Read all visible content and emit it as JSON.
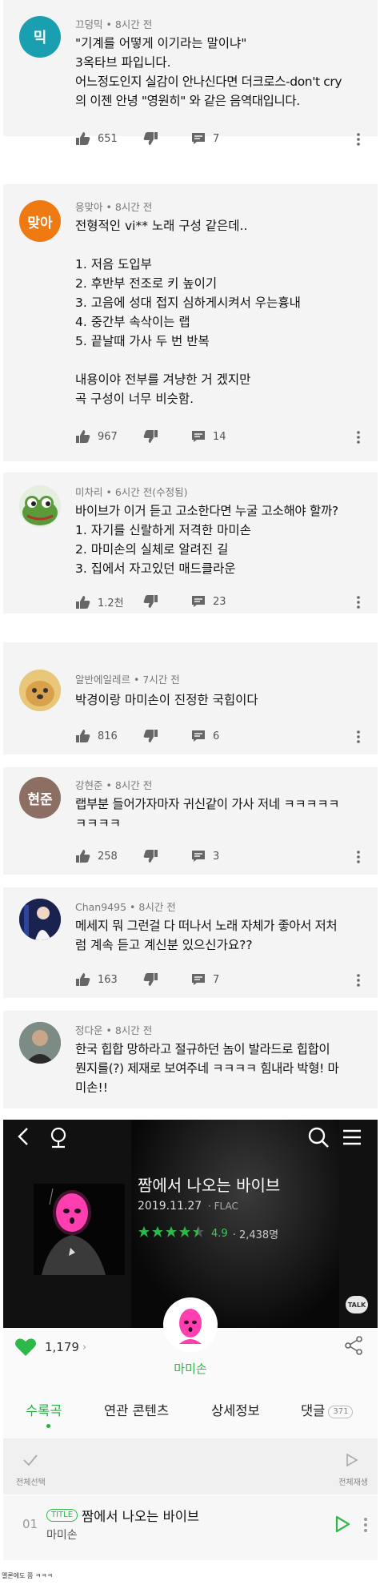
{
  "comments": [
    {
      "author": "끄덩믹",
      "time": "8시간 전",
      "avatar_text": "믹",
      "avatar_color": "#1a9fb0",
      "lines": [
        "\"기계를 어떻게 이기라는 말이냐\"",
        "3옥타브 파입니다.",
        "어느정도인지 실감이 안나신다면 더크로스-don't cry",
        "의 이젠 안녕 \"영원히\" 와 같은 음역대입니다."
      ],
      "likes": "651",
      "replies": "7"
    },
    {
      "author": "응맞아",
      "time": "8시간 전",
      "avatar_text": "맞아",
      "avatar_color": "#f07a12",
      "lines": [
        "전형적인 vi** 노래 구성 같은데..",
        "",
        "1. 저음 도입부",
        "2. 후반부 전조로 키 높이기",
        "3. 고음에 성대 접지 심하게시켜서 우는흉내",
        "4. 중간부 속삭이는 랩",
        "5. 끝날때 가사 두 번 반복",
        "",
        "내용이야 전부를 겨냥한 거 겠지만",
        "곡 구성이 너무 비슷함."
      ],
      "likes": "967",
      "replies": "14"
    },
    {
      "author": "미차리",
      "time": "6시간 전(수정됨)",
      "avatar_text": "",
      "avatar_color": "#d7e6d2",
      "lines": [
        "바이브가 이거 듣고 고소한다면 누굴 고소해야 할까?",
        "1. 자기를 신랄하게 저격한 마미손",
        "2. 마미손의 실체로 알려진 길",
        "3. 집에서 자고있던 매드클라운"
      ],
      "likes": "1.2천",
      "replies": "23"
    },
    {
      "author": "알반에일레르",
      "time": "7시간 전",
      "avatar_text": "",
      "avatar_color": "#e9c77a",
      "lines": [
        "박경이랑 마미손이 진정한 국힙이다"
      ],
      "likes": "816",
      "replies": "6"
    },
    {
      "author": "강현준",
      "time": "8시간 전",
      "avatar_text": "현준",
      "avatar_color": "#8d6e63",
      "lines": [
        "랩부분 들어가자마자 귀신같이 가사 저네 ㅋㅋㅋㅋㅋ",
        "ㅋㅋㅋㅋ"
      ],
      "likes": "258",
      "replies": "3"
    },
    {
      "author": "Chan9495",
      "time": "8시간 전",
      "avatar_text": "",
      "avatar_color": "#1f2a5a",
      "lines": [
        "메세지 뭐 그런걸 다 떠나서 노래 자체가 좋아서  저처",
        "럼 계속 듣고 계신분 있으신가요??"
      ],
      "likes": "163",
      "replies": "7"
    },
    {
      "author": "정다운",
      "time": "8시간 전",
      "avatar_text": "",
      "avatar_color": "#5a6b73",
      "lines": [
        "한국 힙합 망하라고 절규하던 놈이 발라드로 힙합이",
        "뭔지를(?) 제재로 보여주네 ㅋㅋㅋㅋ 힘내라 박형! 마",
        "미손!!"
      ],
      "likes": "",
      "replies": ""
    }
  ],
  "album": {
    "title": "짬에서 나오는 바이브",
    "date": "2019.11.27",
    "format": "FLAC",
    "score": "4.9",
    "rating_count": "2,438명",
    "stars": 4.5,
    "likes": "1,179",
    "artist": "마미손",
    "talk_label": "TALK",
    "accent": "#2fb84a"
  },
  "tabs": [
    {
      "label": "수록곡"
    },
    {
      "label": "연관 콘텐츠"
    },
    {
      "label": "상세정보"
    },
    {
      "label": "댓글"
    }
  ],
  "comment_count_badge": "371",
  "list_head": {
    "select_all": "전체선택",
    "play_all": "전체재생"
  },
  "track": {
    "number": "01",
    "badge": "TITLE",
    "title": "짬에서 나오는 바이브",
    "artist": "마미손"
  },
  "caption": "멜론에도 쯤 ㅋㅋㅋ"
}
